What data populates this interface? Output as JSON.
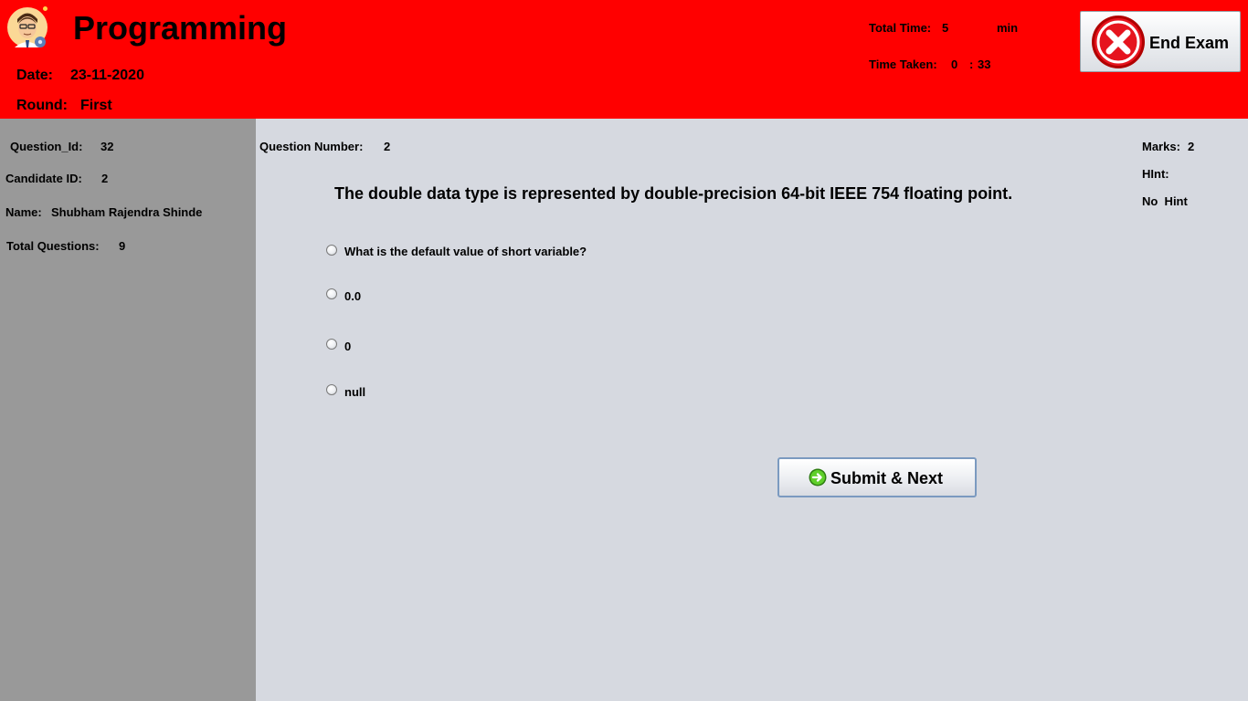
{
  "header": {
    "title": "Programming",
    "date_label": "Date:",
    "date_value": "23-11-2020",
    "round_label": "Round:",
    "round_value": "First",
    "total_time_label": "Total Time:",
    "total_time_value": "5",
    "total_time_unit": "min",
    "time_taken_label": "Time Taken:",
    "time_taken_min": "0",
    "time_taken_sep": ":",
    "time_taken_sec": "33",
    "end_exam_label": "End Exam"
  },
  "sidebar": {
    "question_id_label": "Question_Id:",
    "question_id_value": "32",
    "candidate_id_label": "Candidate ID:",
    "candidate_id_value": "2",
    "name_label": "Name:",
    "name_value": "Shubham Rajendra Shinde",
    "total_questions_label": "Total Questions:",
    "total_questions_value": "9"
  },
  "question": {
    "number_label": "Question Number:",
    "number_value": "2",
    "text": "The double data type is represented by double-precision 64-bit IEEE 754 floating point.",
    "marks_label": "Marks:",
    "marks_value": "2",
    "hint_label": "HInt:",
    "hint_value": "No  Hint",
    "options": [
      "What is the default value of short variable?",
      "0.0",
      "0",
      "null"
    ]
  },
  "submit_label": "Submit & Next",
  "colors": {
    "header": "#ff0000",
    "sidebar": "#999999",
    "main": "#d6d9e0"
  }
}
